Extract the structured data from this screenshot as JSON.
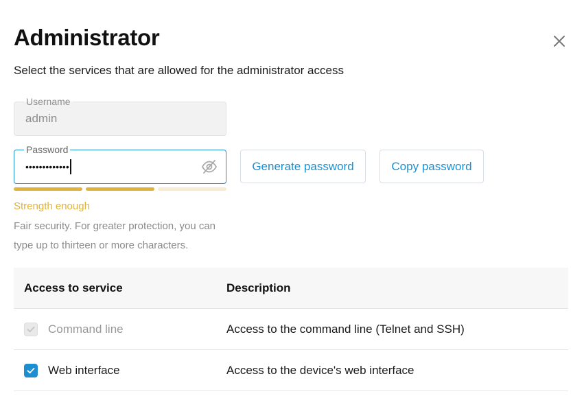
{
  "dialog": {
    "title": "Administrator",
    "subtitle": "Select the services that are allowed for the administrator access"
  },
  "username": {
    "label": "Username",
    "value": "admin"
  },
  "password": {
    "label": "Password",
    "masked_value": "•••••••••••••",
    "toggle_icon": "eye-off-icon"
  },
  "buttons": {
    "generate": "Generate password",
    "copy": "Copy password"
  },
  "strength": {
    "label": "Strength enough",
    "level": 2,
    "segments": 3,
    "active_color": "#e0b33a",
    "inactive_color": "#f7ecd2",
    "hint": "Fair security. For greater protection, you can type up to thirteen or more characters."
  },
  "table": {
    "headers": [
      "Access to service",
      "Description"
    ],
    "rows": [
      {
        "service": "Command line",
        "description": "Access to the command line (Telnet and SSH)",
        "checked": true,
        "disabled": true
      },
      {
        "service": "Web interface",
        "description": "Access to the device's web interface",
        "checked": true,
        "disabled": false
      }
    ]
  },
  "colors": {
    "accent": "#1d8fd1",
    "warning": "#e0b33a"
  }
}
